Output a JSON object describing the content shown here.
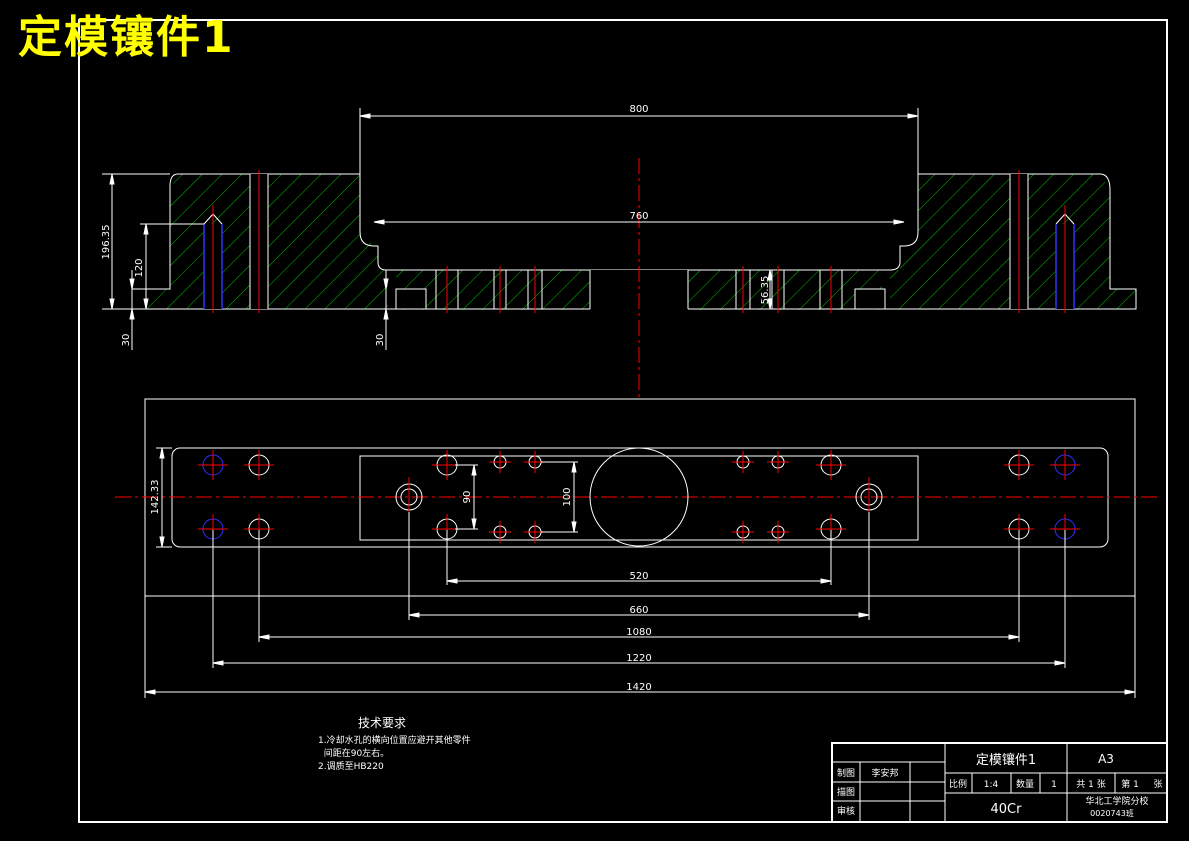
{
  "title_stamp": "定模镶件1",
  "dimensions": {
    "top_width": "800",
    "inner_width": "760",
    "total_height": "196.35",
    "pin_height": "120",
    "bottom_left": "30",
    "bottom_mid": "30",
    "pocket_depth": "56.35",
    "plan_height": "142.33",
    "hole_v1": "90",
    "hole_v2": "100",
    "span_520": "520",
    "span_660": "660",
    "span_1080": "1080",
    "span_1220": "1220",
    "span_1420": "1420"
  },
  "tech_requirements": {
    "heading": "技术要求",
    "line1": "1.冷却水孔的横向位置应避开其他零件",
    "line2": "  间距在90左右。",
    "line3": "2.调质至HB220"
  },
  "title_block": {
    "part_name": "定模镶件1",
    "sheet_size": "A3",
    "drawn_label": "制图",
    "drawn_by": "李安邦",
    "traced_label": "描图",
    "checked_label": "审核",
    "scale_label": "比例",
    "scale_value": "1:4",
    "qty_label": "数量",
    "qty_value": "1",
    "sheets_total": "共 1 张",
    "sheet_num_label": "第 1",
    "sheet_unit": "张",
    "material": "40Cr",
    "school": "华北工学院分校",
    "class_code": "0020743班"
  }
}
